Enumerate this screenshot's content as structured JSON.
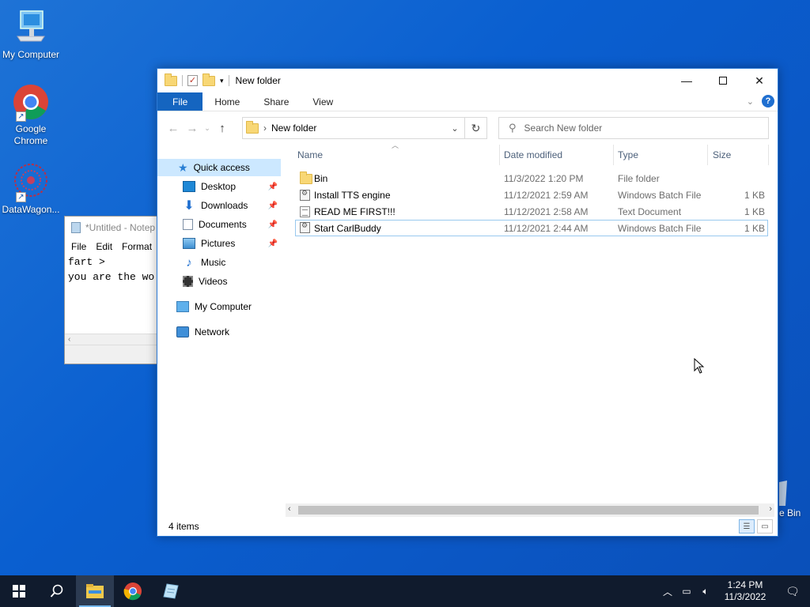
{
  "desktop": {
    "icons": [
      {
        "label": "My Computer"
      },
      {
        "label": "Google Chrome"
      },
      {
        "label": "DataWagon..."
      }
    ],
    "recycle_partial": "e Bin"
  },
  "notepad": {
    "title": "*Untitled - Notep",
    "menu": [
      "File",
      "Edit",
      "Format"
    ],
    "lines": [
      "fart >",
      "you are the wo"
    ]
  },
  "explorer": {
    "title": "New folder",
    "ribbon_tabs": [
      "File",
      "Home",
      "Share",
      "View"
    ],
    "address_crumb": "New folder",
    "search_placeholder": "Search New folder",
    "nav": {
      "quick_access": "Quick access",
      "pinned": [
        "Desktop",
        "Downloads",
        "Documents",
        "Pictures"
      ],
      "unpinned": [
        "Music",
        "Videos"
      ],
      "my_computer": "My Computer",
      "network": "Network"
    },
    "columns": {
      "name": "Name",
      "date": "Date modified",
      "type": "Type",
      "size": "Size"
    },
    "files": [
      {
        "name": "Bin",
        "date": "11/3/2022 1:20 PM",
        "type": "File folder",
        "size": "",
        "kind": "folder"
      },
      {
        "name": "Install TTS engine",
        "date": "11/12/2021 2:59 AM",
        "type": "Windows Batch File",
        "size": "1 KB",
        "kind": "bat"
      },
      {
        "name": "READ ME FIRST!!!",
        "date": "11/12/2021 2:58 AM",
        "type": "Text Document",
        "size": "1 KB",
        "kind": "txt"
      },
      {
        "name": "Start CarlBuddy",
        "date": "11/12/2021 2:44 AM",
        "type": "Windows Batch File",
        "size": "1 KB",
        "kind": "bat"
      }
    ],
    "status": "4 items"
  },
  "taskbar": {
    "time": "1:24 PM",
    "date": "11/3/2022"
  },
  "colors": {
    "accent": "#1565c0",
    "selection": "#cce8ff",
    "taskbar": "#101b2d"
  }
}
